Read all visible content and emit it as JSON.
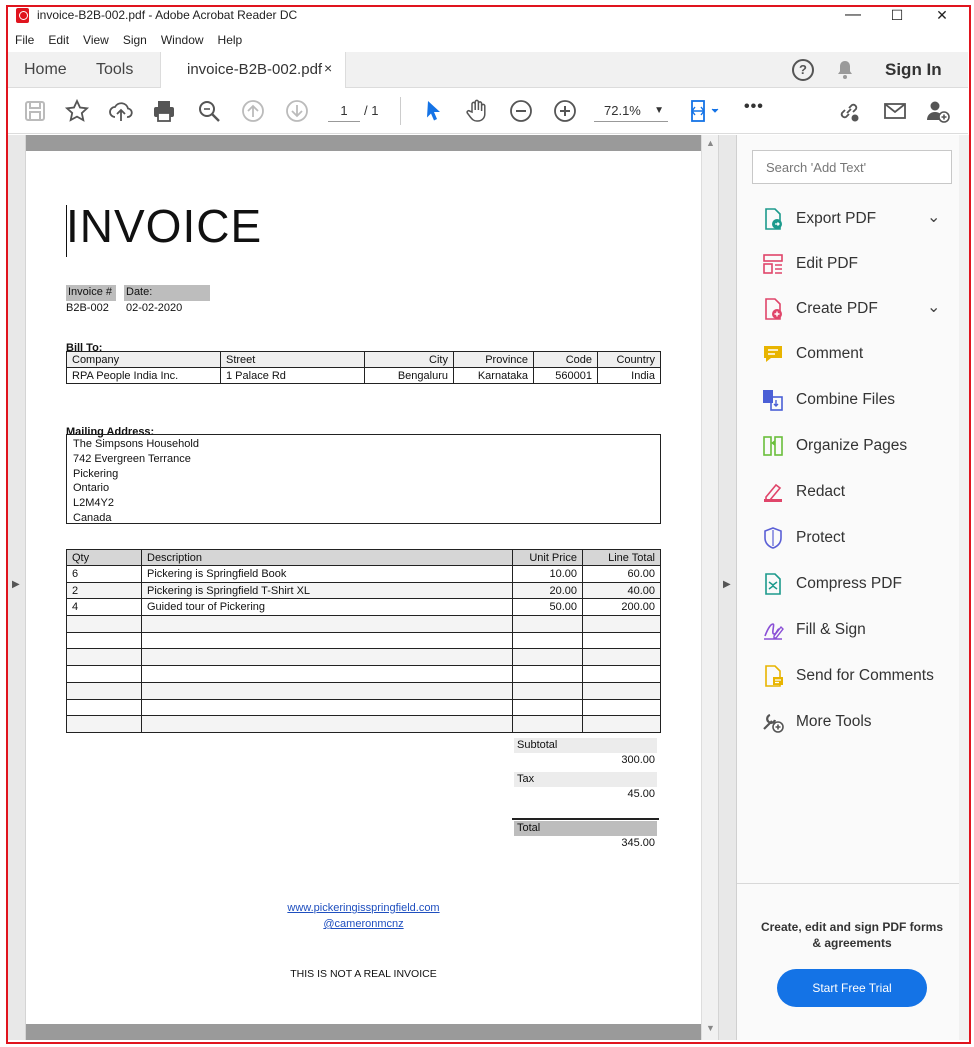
{
  "window": {
    "title": "invoice-B2B-002.pdf - Adobe Acrobat Reader DC",
    "minimize": "—",
    "maximize": "☐",
    "close": "✕"
  },
  "menu": [
    "File",
    "Edit",
    "View",
    "Sign",
    "Window",
    "Help"
  ],
  "tabs": {
    "home": "Home",
    "tools": "Tools",
    "document": "invoice-B2B-002.pdf",
    "close": "×",
    "help": "?",
    "sign_in": "Sign In"
  },
  "toolbar": {
    "page_current": "1",
    "page_total": "/ 1",
    "zoom": "72.1%",
    "more": "•••"
  },
  "document": {
    "title": "INVOICE",
    "invoice_label": "Invoice #",
    "date_label": "Date:",
    "invoice_number": "B2B-002",
    "date": "02-02-2020",
    "bill_to_label": "Bill To:",
    "bill_to_headers": [
      "Company",
      "Street",
      "City",
      "Province",
      "Code",
      "Country"
    ],
    "bill_to_row": [
      "RPA People India Inc.",
      "1 Palace Rd",
      "Bengaluru",
      "Karnataka",
      "560001",
      "India"
    ],
    "mailing_label": "Mailing Address:",
    "mailing_lines": [
      "The Simpsons Household",
      "742 Evergreen Terrance",
      "Pickering",
      "Ontario",
      "L2M4Y2",
      "Canada"
    ],
    "items_headers": [
      "Qty",
      "Description",
      "Unit Price",
      "Line Total"
    ],
    "items": [
      [
        "6",
        "Pickering is Springfield Book",
        "10.00",
        "60.00"
      ],
      [
        "2",
        "Pickering is Springfield T-Shirt XL",
        "20.00",
        "40.00"
      ],
      [
        "4",
        "Guided tour of Pickering",
        "50.00",
        "200.00"
      ]
    ],
    "subtotal_label": "Subtotal",
    "subtotal": "300.00",
    "tax_label": "Tax",
    "tax": "45.00",
    "total_label": "Total",
    "total": "345.00",
    "website": "www.pickeringisspringfield.com",
    "handle": "@cameronmcnz",
    "disclaimer": "THIS IS NOT A REAL INVOICE"
  },
  "right_pane": {
    "search_placeholder": "Search 'Add Text'",
    "tools": [
      {
        "label": "Export PDF",
        "icon": "export-pdf-icon",
        "color": "#1c9a8c"
      },
      {
        "label": "Edit PDF",
        "icon": "edit-pdf-icon",
        "color": "#e0456a"
      },
      {
        "label": "Create PDF",
        "icon": "create-pdf-icon",
        "color": "#e0456a"
      },
      {
        "label": "Comment",
        "icon": "comment-icon",
        "color": "#e8b400"
      },
      {
        "label": "Combine Files",
        "icon": "combine-files-icon",
        "color": "#4a5fd6"
      },
      {
        "label": "Organize Pages",
        "icon": "organize-pages-icon",
        "color": "#6abf3b"
      },
      {
        "label": "Redact",
        "icon": "redact-icon",
        "color": "#e0456a"
      },
      {
        "label": "Protect",
        "icon": "protect-icon",
        "color": "#5a5fd6"
      },
      {
        "label": "Compress PDF",
        "icon": "compress-pdf-icon",
        "color": "#1c9a8c"
      },
      {
        "label": "Fill & Sign",
        "icon": "fill-sign-icon",
        "color": "#8a4fd6"
      },
      {
        "label": "Send for Comments",
        "icon": "send-comments-icon",
        "color": "#e8b400"
      },
      {
        "label": "More Tools",
        "icon": "more-tools-icon",
        "color": "#555555"
      }
    ],
    "promo": "Create, edit and sign PDF forms & agreements",
    "trial_button": "Start Free Trial"
  }
}
